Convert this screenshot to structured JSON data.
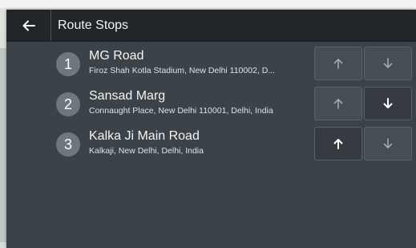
{
  "header": {
    "title": "Route Stops"
  },
  "stops": [
    {
      "number": "1",
      "name": "MG Road",
      "address": "Firoz Shah Kotla Stadium, New Delhi 110002, D...",
      "up_enabled": false,
      "down_enabled": false
    },
    {
      "number": "2",
      "name": "Sansad Marg",
      "address": "Connaught Place, New Delhi 110001, Delhi, India",
      "up_enabled": false,
      "down_enabled": true
    },
    {
      "number": "3",
      "name": "Kalka Ji Main Road",
      "address": "Kalkaji, New Delhi, Delhi, India",
      "up_enabled": true,
      "down_enabled": false
    }
  ],
  "icons": {
    "back": "arrow-left-icon",
    "move_up": "arrow-up-icon",
    "move_down": "arrow-down-icon"
  },
  "colors": {
    "header_bg": "#222629",
    "panel_bg": "#3b4349",
    "badge_bg": "#6f767c",
    "arrow_enabled": "#ffffff",
    "arrow_disabled": "#a3a9ad"
  }
}
